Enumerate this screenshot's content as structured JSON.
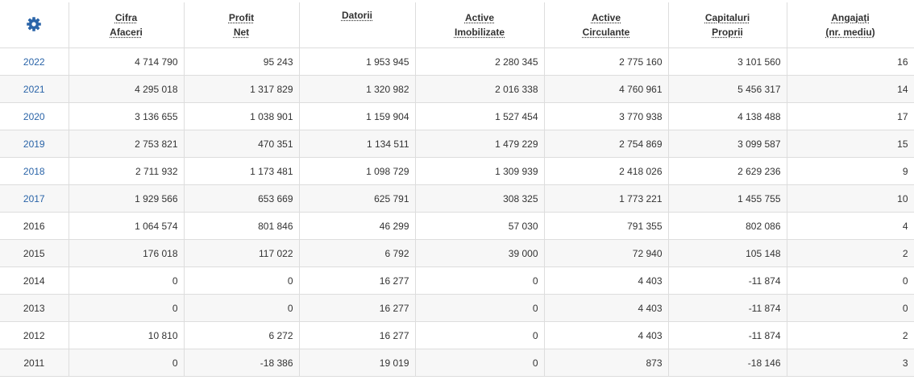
{
  "table": {
    "headers": [
      {
        "line1": "Cifra",
        "line2": "Afaceri"
      },
      {
        "line1": "Profit",
        "line2": "Net"
      },
      {
        "line1": "Datorii",
        "line2": ""
      },
      {
        "line1": "Active",
        "line2": "Imobilizate"
      },
      {
        "line1": "Active",
        "line2": "Circulante"
      },
      {
        "line1": "Capitaluri",
        "line2": "Proprii"
      },
      {
        "line1": "Angajați",
        "line2": "(nr. mediu)"
      }
    ],
    "rows": [
      {
        "year": "2022",
        "link": true,
        "cells": [
          "4 714 790",
          "95 243",
          "1 953 945",
          "2 280 345",
          "2 775 160",
          "3 101 560",
          "16"
        ]
      },
      {
        "year": "2021",
        "link": true,
        "cells": [
          "4 295 018",
          "1 317 829",
          "1 320 982",
          "2 016 338",
          "4 760 961",
          "5 456 317",
          "14"
        ]
      },
      {
        "year": "2020",
        "link": true,
        "cells": [
          "3 136 655",
          "1 038 901",
          "1 159 904",
          "1 527 454",
          "3 770 938",
          "4 138 488",
          "17"
        ]
      },
      {
        "year": "2019",
        "link": true,
        "cells": [
          "2 753 821",
          "470 351",
          "1 134 511",
          "1 479 229",
          "2 754 869",
          "3 099 587",
          "15"
        ]
      },
      {
        "year": "2018",
        "link": true,
        "cells": [
          "2 711 932",
          "1 173 481",
          "1 098 729",
          "1 309 939",
          "2 418 026",
          "2 629 236",
          "9"
        ]
      },
      {
        "year": "2017",
        "link": true,
        "cells": [
          "1 929 566",
          "653 669",
          "625 791",
          "308 325",
          "1 773 221",
          "1 455 755",
          "10"
        ]
      },
      {
        "year": "2016",
        "link": false,
        "cells": [
          "1 064 574",
          "801 846",
          "46 299",
          "57 030",
          "791 355",
          "802 086",
          "4"
        ]
      },
      {
        "year": "2015",
        "link": false,
        "cells": [
          "176 018",
          "117 022",
          "6 792",
          "39 000",
          "72 940",
          "105 148",
          "2"
        ]
      },
      {
        "year": "2014",
        "link": false,
        "cells": [
          "0",
          "0",
          "16 277",
          "0",
          "4 403",
          "-11 874",
          "0"
        ]
      },
      {
        "year": "2013",
        "link": false,
        "cells": [
          "0",
          "0",
          "16 277",
          "0",
          "4 403",
          "-11 874",
          "0"
        ]
      },
      {
        "year": "2012",
        "link": false,
        "cells": [
          "10 810",
          "6 272",
          "16 277",
          "0",
          "4 403",
          "-11 874",
          "2"
        ]
      },
      {
        "year": "2011",
        "link": false,
        "cells": [
          "0",
          "-18 386",
          "19 019",
          "0",
          "873",
          "-18 146",
          "3"
        ]
      }
    ]
  },
  "icons": {
    "settings": "gear-icon"
  },
  "colors": {
    "link": "#2a64a8",
    "gear": "#2a64a8",
    "row_alt": "#f7f7f7",
    "border": "#dddddd"
  }
}
